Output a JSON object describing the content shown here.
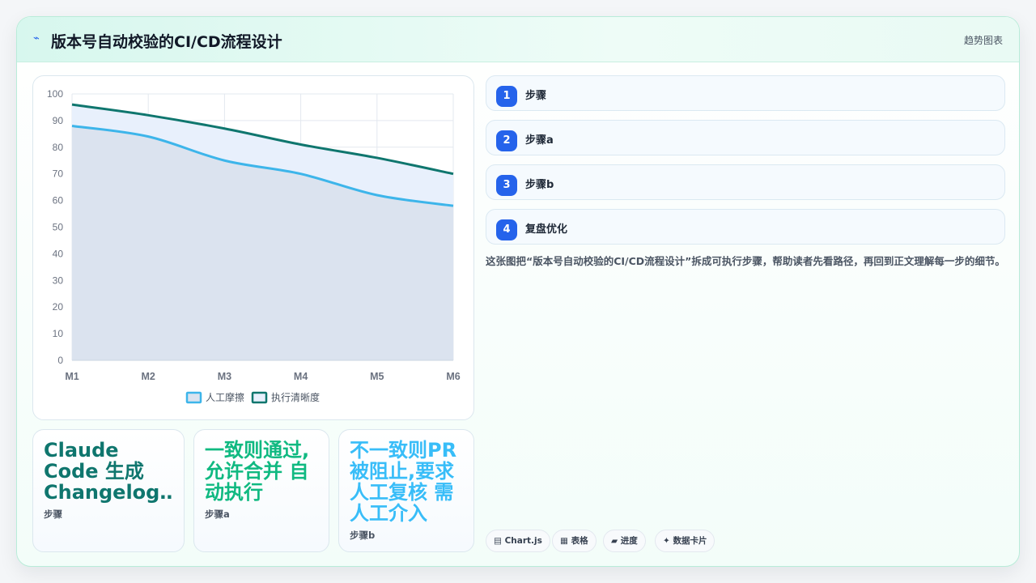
{
  "header": {
    "icon": "sparkline-icon",
    "title": "版本号自动校验的CI/CD流程设计",
    "tag": "趋势图表"
  },
  "steps": [
    {
      "num": "1",
      "label": "步骤"
    },
    {
      "num": "2",
      "label": "步骤a"
    },
    {
      "num": "3",
      "label": "步骤b"
    },
    {
      "num": "4",
      "label": "复盘优化"
    }
  ],
  "description": "这张图把“版本号自动校验的CI/CD流程设计”拆成可执行步骤，帮助读者先看路径，再回到正文理解每一步的细节。",
  "tiles": [
    {
      "value": "Claude Code 生成 Changelog…",
      "label": "步骤",
      "color": "#0f766e"
    },
    {
      "value": "一致则通过,允许合并 自动执行",
      "label": "步骤a",
      "color": "#10b981"
    },
    {
      "value": "不一致则PR被阻止,要求人工复核 需人工介入",
      "label": "步骤b",
      "color": "#38bdf8"
    }
  ],
  "chips": [
    {
      "icon": "chart-icon",
      "glyph": "▤",
      "label": "Chart.js"
    },
    {
      "icon": "table-icon",
      "glyph": "▦",
      "label": "表格"
    },
    {
      "icon": "progress-icon",
      "glyph": "▰",
      "label": "进度"
    },
    {
      "icon": "card-icon",
      "glyph": "✦",
      "label": "数据卡片"
    }
  ],
  "chart_data": {
    "type": "area",
    "categories": [
      "M1",
      "M2",
      "M3",
      "M4",
      "M5",
      "M6"
    ],
    "ylim": [
      0,
      100
    ],
    "yticks": [
      0,
      10,
      20,
      30,
      40,
      50,
      60,
      70,
      80,
      90,
      100
    ],
    "grid": true,
    "legend_position": "bottom",
    "series": [
      {
        "name": "人工摩擦",
        "values": [
          88,
          84,
          75,
          70,
          62,
          58
        ],
        "color": "#3db5ea",
        "fill": "#dbe3ef"
      },
      {
        "name": "执行清晰度",
        "values": [
          96,
          92,
          87,
          81,
          76,
          70
        ],
        "color": "#0f766e",
        "fill": "#e8f0fc"
      }
    ]
  }
}
